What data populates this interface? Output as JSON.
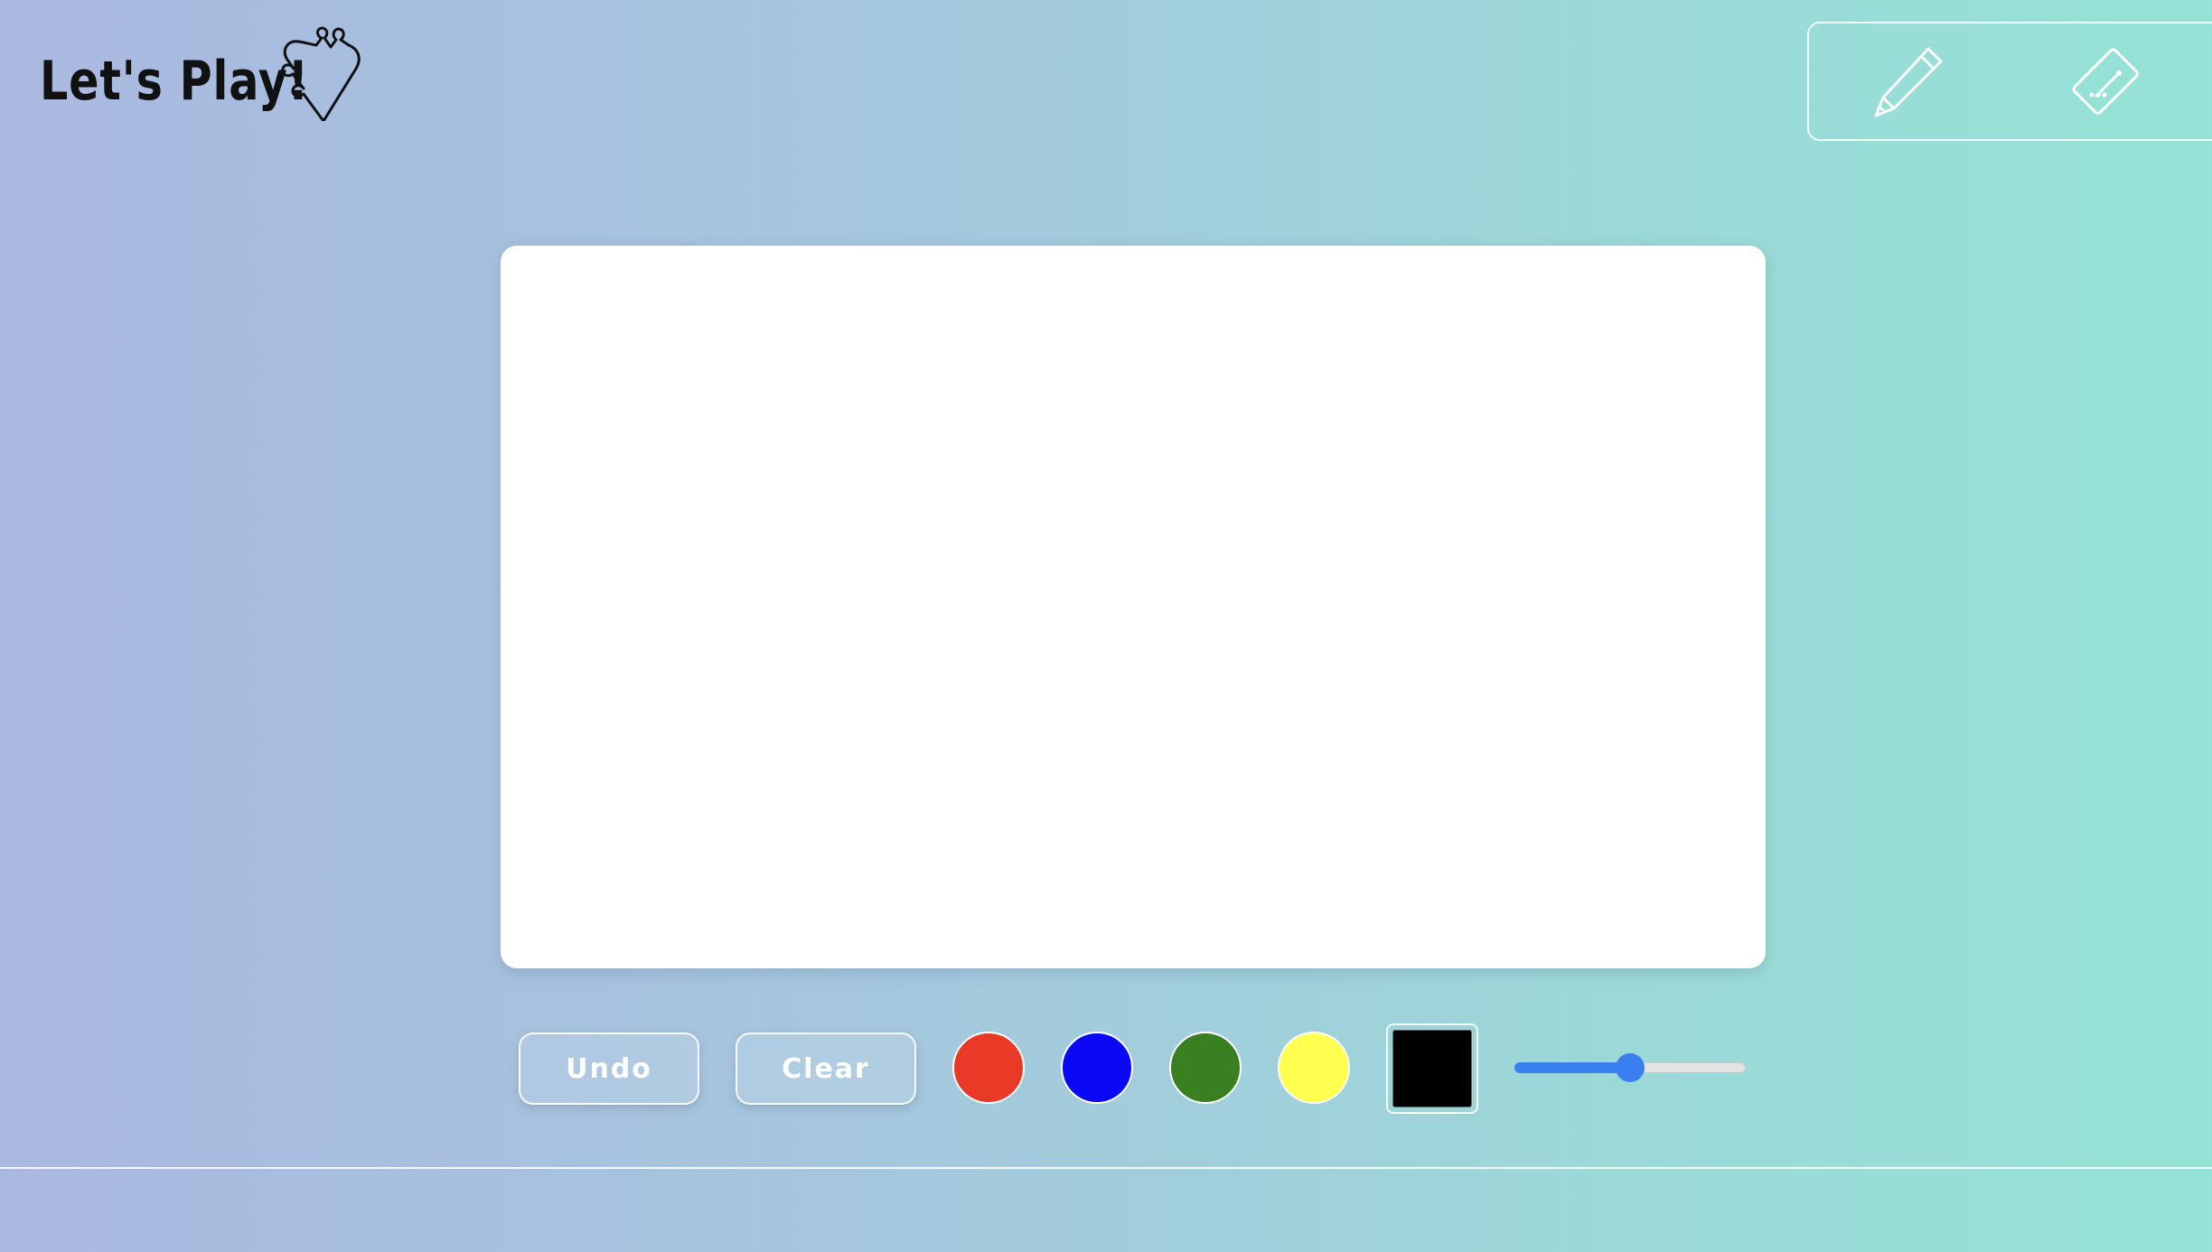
{
  "header": {
    "title": "Let's Play!",
    "logo_icon": "puzzle-heart-icon"
  },
  "tools": [
    {
      "name": "pencil",
      "icon": "pencil-icon",
      "selected": true
    },
    {
      "name": "eraser",
      "icon": "eraser-icon",
      "selected": false
    }
  ],
  "toolbar": {
    "undo_label": "Undo",
    "clear_label": "Clear",
    "colors": [
      "#e83a26",
      "#0a08f5",
      "#3a7f22",
      "#ffff4f"
    ],
    "current_color": "#000000",
    "brush_size_fraction": 0.5
  },
  "theme": {
    "accent": "#3a7ff0",
    "canvas_background": "#ffffff"
  }
}
